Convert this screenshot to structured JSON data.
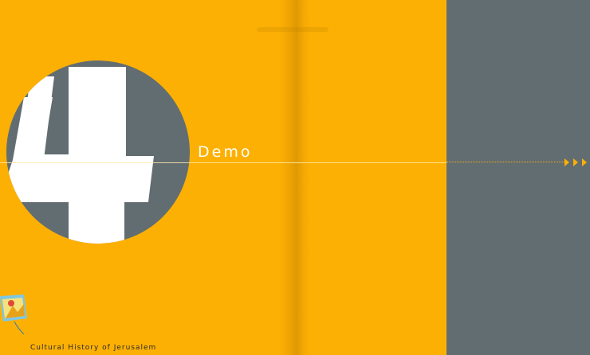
{
  "chapter": {
    "number": "4",
    "title": "Demo"
  },
  "footer": {
    "text": "Cultural History of Jerusalem"
  },
  "colors": {
    "page_yellow": "#fdb004",
    "panel_gray": "#626d72",
    "numeral_white": "#ffffff"
  },
  "icons": {
    "logo": "jerusalem-logo-icon",
    "arrows": "triple-arrow-icon"
  }
}
